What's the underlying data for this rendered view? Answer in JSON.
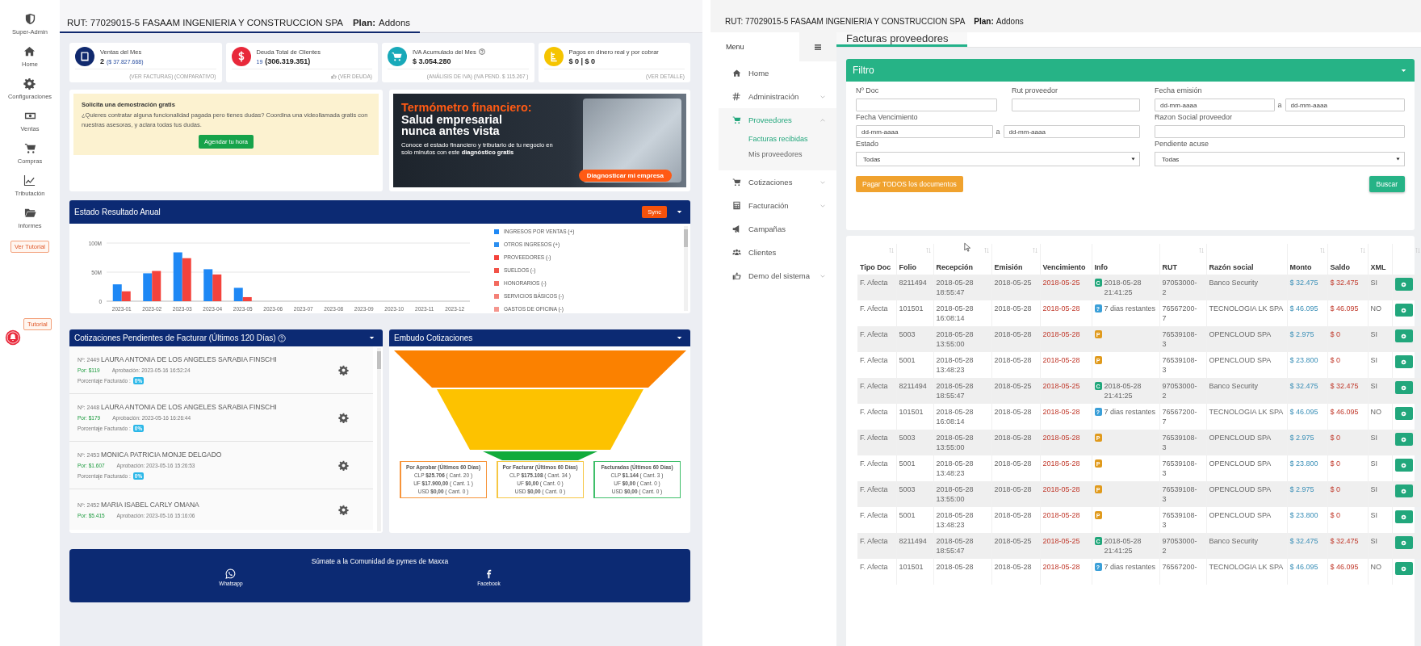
{
  "left": {
    "sidebar": {
      "items": [
        {
          "label": "Super-Admin"
        },
        {
          "label": "Home"
        },
        {
          "label": "Configuraciones"
        },
        {
          "label": "Ventas"
        },
        {
          "label": "Compras"
        },
        {
          "label": "Tributación"
        },
        {
          "label": "Informes"
        }
      ],
      "tutorial_button": "Ver Tutorial",
      "floating_tutorial": "Tutorial"
    },
    "header": {
      "rut": "RUT: 77029015-5 FASAAM INGENIERIA Y CONSTRUCCION SPA",
      "plan_label": "Plan:",
      "plan": "Addons"
    },
    "stat_cards": [
      {
        "title": "Ventas del Mes",
        "value_parts": [
          {
            "text": "2",
            "kind": "bold"
          },
          {
            "text": "($ 37.827.668)",
            "kind": "link"
          }
        ],
        "footer": "(VER FACTURAS) (COMPARATIVO)"
      },
      {
        "title": "Deuda Total de Clientes",
        "value_parts": [
          {
            "text": "19",
            "kind": "link"
          },
          {
            "text": "(306.319.351)",
            "kind": "bold"
          }
        ],
        "footer": "(VER DEUDA)"
      },
      {
        "title": "IVA Acumulado del Mes",
        "value_parts": [
          {
            "text": "$ 3.054.280",
            "kind": "bold"
          }
        ],
        "footer": "(ANÁLISIS DE IVA) (IVA PEND. $ 115.267 )"
      },
      {
        "title": "Pagos en dinero real y por cobrar",
        "value_parts": [
          {
            "text": "$ 0 | $ 0",
            "kind": "bold"
          }
        ],
        "footer": "(VER DETALLE)"
      }
    ],
    "demo_card": {
      "title": "Solicita una demostración gratis",
      "text": "¿Quieres contratar alguna funcionalidad pagada pero tienes dudas? Coordina una videollamada gratis con nuestras asesoras, y aclara todas tus dudas.",
      "button": "Agendar tu hora"
    },
    "banner": {
      "title": "Termómetro financiero:",
      "subtitle": "Salud empresarial nunca antes vista",
      "text": "Conoce el estado financiero y tributario de tu negocio en solo minutos con este **diagnóstico gratis**",
      "button": "Diagnosticar mi empresa"
    },
    "chart_panel": {
      "title": "Estado Resultado Anual",
      "sync_button": "Sync",
      "chart_data": {
        "type": "bar",
        "categories": [
          "2023-01",
          "2023-02",
          "2023-03",
          "2023-04",
          "2023-05",
          "2023-06",
          "2023-07",
          "2023-08",
          "2023-09",
          "2023-10",
          "2023-11",
          "2023-12"
        ],
        "series": [
          {
            "name": "INGRESOS POR VENTAS (+)",
            "color": "#1e88f5",
            "values": [
              29,
              48,
              84,
              55,
              23,
              0,
              0,
              0,
              0,
              0,
              0,
              0
            ]
          },
          {
            "name": "OTROS INGRESOS (+)",
            "color": "#2b8ff0",
            "values": [
              0,
              0,
              0,
              0,
              0,
              0,
              0,
              0,
              0,
              0,
              0,
              0
            ]
          },
          {
            "name": "PROVEEDORES (-)",
            "color": "#f4433c",
            "values": [
              17,
              52,
              74,
              46,
              7,
              0,
              0,
              0,
              0,
              0,
              0,
              0
            ]
          },
          {
            "name": "SUELDOS (-)",
            "color": "#f25247",
            "values": [
              0,
              0,
              0,
              0,
              0,
              0,
              0,
              0,
              0,
              0,
              0,
              0
            ]
          },
          {
            "name": "HONORARIOS (-)",
            "color": "#f36a5e",
            "values": [
              0,
              0,
              0,
              0,
              0,
              0,
              0,
              0,
              0,
              0,
              0,
              0
            ]
          },
          {
            "name": "SERVICIOS BÁSICOS (-)",
            "color": "#f48076",
            "values": [
              0,
              0,
              0,
              0,
              0,
              0,
              0,
              0,
              0,
              0,
              0,
              0
            ]
          },
          {
            "name": "GASTOS DE OFICINA (-)",
            "color": "#f5968e",
            "values": [
              0,
              0,
              0,
              0,
              0,
              0,
              0,
              0,
              0,
              0,
              0,
              0
            ]
          }
        ],
        "ylim": [
          0,
          100
        ],
        "yticks": [
          {
            "value": 0,
            "label": "0"
          },
          {
            "value": 50,
            "label": "50M"
          },
          {
            "value": 100,
            "label": "100M"
          }
        ]
      }
    },
    "quotes_panel": {
      "title": "Cotizaciones Pendientes de Facturar (Últimos 120 Días)",
      "items": [
        {
          "number": "Nº: 2449",
          "name": "LAURA ANTONIA DE LOS ANGELES SARABIA FINSCHI",
          "amount": "Por: $119",
          "approval": "Aprobación: 2023-05-16 16:52:24",
          "percent_label": "Porcentaje Facturado :",
          "percent": "0%"
        },
        {
          "number": "Nº: 2448",
          "name": "LAURA ANTONIA DE LOS ANGELES SARABIA FINSCHI",
          "amount": "Por: $179",
          "approval": "Aprobación: 2023-05-16 16:26:44",
          "percent_label": "Porcentaje Facturado :",
          "percent": "0%"
        },
        {
          "number": "Nº: 2453",
          "name": "MONICA PATRICIA MONJE DELGADO",
          "amount": "Por: $1.607",
          "approval": "Aprobación: 2023-05-16 15:26:53",
          "percent_label": "Porcentaje Facturado :",
          "percent": "0%"
        },
        {
          "number": "Nº: 2452",
          "name": "MARIA ISABEL CARLY OMANA",
          "amount": "Por: $5.415",
          "approval": "Aprobación: 2023-05-16 15:16:06"
        }
      ]
    },
    "funnel_panel": {
      "title": "Embudo Cotizaciones",
      "boxes": [
        {
          "title": "Por Aprobar (Últimos 60 Días)",
          "color": "#f7943a",
          "lines": [
            "CLP **$25.706** ( Cant. 20 )",
            "UF **$17.900,00** ( Cant. 1 )",
            "USD **$0,00** ( Cant. 0 )"
          ]
        },
        {
          "title": "Por Facturar (Últimos 60 Días)",
          "color": "#f6c744",
          "lines": [
            "CLP **$175.108** ( Cant. 34 )",
            "UF **$0,00** ( Cant. 0 )",
            "USD **$0,00** ( Cant. 0 )"
          ]
        },
        {
          "title": "Facturadas (Últimos 60 Días)",
          "color": "#3fbf6a",
          "lines": [
            "CLP **$1.144** ( Cant. 3 )",
            "UF **$0,00** ( Cant. 0 )",
            "USD **$0,00** ( Cant. 0 )"
          ]
        }
      ]
    },
    "community": {
      "text": "Súmate a la Comunidad de pymes de Maxxa",
      "links": [
        {
          "label": "Whatsapp"
        },
        {
          "label": "Facebook"
        }
      ]
    }
  },
  "right": {
    "header": {
      "rut": "RUT: 77029015-5 FASAAM INGENIERIA Y CONSTRUCCION SPA",
      "plan_label": "Plan:",
      "plan": "Addons"
    },
    "menu": {
      "title": "Menu",
      "items": [
        {
          "label": "Home",
          "kind": "link",
          "selected": false
        },
        {
          "label": "Administración",
          "kind": "group",
          "expanded": false,
          "selected": false
        },
        {
          "label": "Proveedores",
          "kind": "group",
          "expanded": true,
          "selected": true,
          "children": [
            {
              "label": "Facturas recibidas",
              "selected": true
            },
            {
              "label": "Mis proveedores",
              "selected": false
            }
          ]
        },
        {
          "label": "Cotizaciones",
          "kind": "group",
          "expanded": false,
          "selected": false
        },
        {
          "label": "Facturación",
          "kind": "group",
          "expanded": false,
          "selected": false
        },
        {
          "label": "Campañas",
          "kind": "link",
          "selected": false
        },
        {
          "label": "Clientes",
          "kind": "link",
          "selected": false
        },
        {
          "label": "Demo del sistema",
          "kind": "group",
          "expanded": false,
          "selected": false
        }
      ]
    },
    "page_tab": "Facturas proveedores",
    "filter": {
      "title": "Filtro",
      "fields": [
        {
          "label": "Nº Doc",
          "kind": "text"
        },
        {
          "label": "Rut proveedor",
          "kind": "text"
        },
        {
          "label": "Fecha emisión",
          "kind": "range",
          "placeholder": "dd-mm-aaaa",
          "separator": "a",
          "placeholder_to": "dd-mm-aaaa"
        },
        {
          "label": "Fecha Vencimiento",
          "kind": "range",
          "placeholder": "dd-mm-aaaa",
          "separator": "a",
          "placeholder_to": "dd-mm-aaaa"
        },
        {
          "label": "Razon Social proveedor",
          "kind": "text"
        },
        {
          "label": "Estado",
          "kind": "select",
          "value": "Todas"
        },
        {
          "label": "Pendiente acuse",
          "kind": "select",
          "value": "Todas"
        }
      ],
      "pay_all_button": "Pagar TODOS los documentos",
      "search_button": "Buscar"
    },
    "table": {
      "columns": [
        {
          "label": "Tipo Doc",
          "sortable": true
        },
        {
          "label": "Folio",
          "sortable": true
        },
        {
          "label": "Recepción",
          "sortable": true
        },
        {
          "label": "Emisión",
          "sortable": true
        },
        {
          "label": "Vencimiento",
          "sortable": false
        },
        {
          "label": "Info",
          "sortable": false
        },
        {
          "label": "RUT",
          "sortable": true
        },
        {
          "label": "Razón social",
          "sortable": false
        },
        {
          "label": "Monto",
          "sortable": true
        },
        {
          "label": "Saldo",
          "sortable": true
        },
        {
          "label": "XML",
          "sortable": false
        },
        {
          "sortable": true
        }
      ],
      "rows": [
        {
          "tipo": "F. Afecta",
          "folio": "8211494",
          "recepcion": "2018-05-28 18:55:47",
          "emision": "2018-05-25",
          "vencimiento": "2018-05-25",
          "info": {
            "badge": "C",
            "color": "#1fa67a",
            "text": "2018-05-28 21:41:25"
          },
          "rut": "97053000-2",
          "razon_social": "Banco Security",
          "monto": "$ 32.475",
          "saldo": "$ 32.475",
          "xml": "SI"
        },
        {
          "tipo": "F. Afecta",
          "folio": "101501",
          "recepcion": "2018-05-28 16:08:14",
          "emision": "2018-05-28",
          "vencimiento": "2018-05-28",
          "info": {
            "badge": "?",
            "color": "#3a9fd8",
            "text": "7 dias restantes"
          },
          "rut": "76567200-7",
          "razon_social": "TECNOLOGIA LK SPA",
          "monto": "$ 46.095",
          "saldo": "$ 46.095",
          "xml": "NO"
        },
        {
          "tipo": "F. Afecta",
          "folio": "5003",
          "recepcion": "2018-05-28 13:55:00",
          "emision": "2018-05-28",
          "vencimiento": "2018-05-28",
          "info": {
            "badge": "P",
            "color": "#e09a1c"
          },
          "rut": "76539108-3",
          "razon_social": "OPENCLOUD SPA",
          "monto": "$ 2.975",
          "saldo": "$ 0",
          "xml": "SI"
        },
        {
          "tipo": "F. Afecta",
          "folio": "5001",
          "recepcion": "2018-05-28 13:48:23",
          "emision": "2018-05-28",
          "vencimiento": "2018-05-28",
          "info": {
            "badge": "P",
            "color": "#e09a1c"
          },
          "rut": "76539108-3",
          "razon_social": "OPENCLOUD SPA",
          "monto": "$ 23.800",
          "saldo": "$ 0",
          "xml": "SI"
        },
        {
          "tipo": "F. Afecta",
          "folio": "8211494",
          "recepcion": "2018-05-28 18:55:47",
          "emision": "2018-05-25",
          "vencimiento": "2018-05-25",
          "info": {
            "badge": "C",
            "color": "#1fa67a",
            "text": "2018-05-28 21:41:25"
          },
          "rut": "97053000-2",
          "razon_social": "Banco Security",
          "monto": "$ 32.475",
          "saldo": "$ 32.475",
          "xml": "SI"
        },
        {
          "tipo": "F. Afecta",
          "folio": "101501",
          "recepcion": "2018-05-28 16:08:14",
          "emision": "2018-05-28",
          "vencimiento": "2018-05-28",
          "info": {
            "badge": "?",
            "color": "#3a9fd8",
            "text": "7 dias restantes"
          },
          "rut": "76567200-7",
          "razon_social": "TECNOLOGIA LK SPA",
          "monto": "$ 46.095",
          "saldo": "$ 46.095",
          "xml": "NO"
        },
        {
          "tipo": "F. Afecta",
          "folio": "5003",
          "recepcion": "2018-05-28 13:55:00",
          "emision": "2018-05-28",
          "vencimiento": "2018-05-28",
          "info": {
            "badge": "P",
            "color": "#e09a1c"
          },
          "rut": "76539108-3",
          "razon_social": "OPENCLOUD SPA",
          "monto": "$ 2.975",
          "saldo": "$ 0",
          "xml": "SI"
        },
        {
          "tipo": "F. Afecta",
          "folio": "5001",
          "recepcion": "2018-05-28 13:48:23",
          "emision": "2018-05-28",
          "vencimiento": "2018-05-28",
          "info": {
            "badge": "P",
            "color": "#e09a1c"
          },
          "rut": "76539108-3",
          "razon_social": "OPENCLOUD SPA",
          "monto": "$ 23.800",
          "saldo": "$ 0",
          "xml": "SI"
        },
        {
          "tipo": "F. Afecta",
          "folio": "5003",
          "recepcion": "2018-05-28 13:55:00",
          "emision": "2018-05-28",
          "vencimiento": "2018-05-28",
          "info": {
            "badge": "P",
            "color": "#e09a1c"
          },
          "rut": "76539108-3",
          "razon_social": "OPENCLOUD SPA",
          "monto": "$ 2.975",
          "saldo": "$ 0",
          "xml": "SI"
        },
        {
          "tipo": "F. Afecta",
          "folio": "5001",
          "recepcion": "2018-05-28 13:48:23",
          "emision": "2018-05-28",
          "vencimiento": "2018-05-28",
          "info": {
            "badge": "P",
            "color": "#e09a1c"
          },
          "rut": "76539108-3",
          "razon_social": "OPENCLOUD SPA",
          "monto": "$ 23.800",
          "saldo": "$ 0",
          "xml": "SI"
        },
        {
          "tipo": "F. Afecta",
          "folio": "8211494",
          "recepcion": "2018-05-28 18:55:47",
          "emision": "2018-05-25",
          "vencimiento": "2018-05-25",
          "info": {
            "badge": "C",
            "color": "#1fa67a",
            "text": "2018-05-28 21:41:25"
          },
          "rut": "97053000-2",
          "razon_social": "Banco Security",
          "monto": "$ 32.475",
          "saldo": "$ 32.475",
          "xml": "SI"
        },
        {
          "tipo": "F. Afecta",
          "folio": "101501",
          "recepcion": "2018-05-28",
          "emision": "2018-05-28",
          "vencimiento": "2018-05-28",
          "info": {
            "badge": "?",
            "color": "#3a9fd8",
            "text": "7 dias restantes"
          },
          "rut": "76567200-",
          "razon_social": "TECNOLOGIA LK SPA",
          "monto": "$ 46.095",
          "saldo": "$ 46.095",
          "xml": "NO"
        }
      ]
    }
  }
}
